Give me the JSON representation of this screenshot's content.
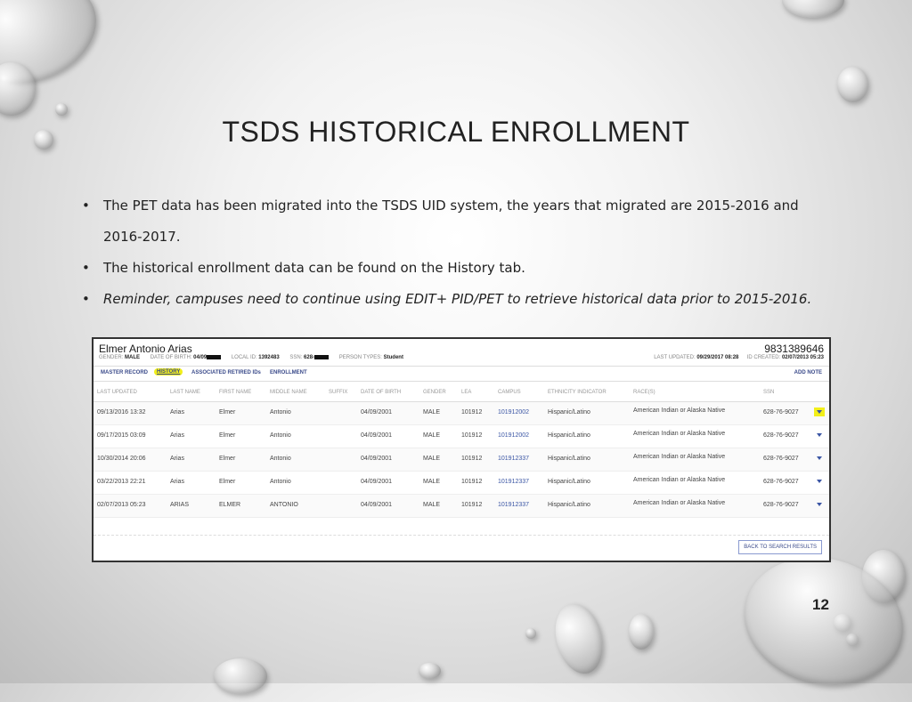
{
  "slide": {
    "title": "TSDS HISTORICAL ENROLLMENT",
    "bullets": [
      "The PET data has been migrated into the TSDS UID system, the years that migrated are 2015-2016 and 2016-2017.",
      "The historical enrollment data can be found on the History tab.",
      "Reminder, campuses need to continue using EDIT+ PID/PET to retrieve historical data prior to 2015-2016."
    ],
    "page_number": "12"
  },
  "record": {
    "name": "Elmer Antonio Arias",
    "id": "9831389646",
    "gender_label": "GENDER:",
    "gender": "MALE",
    "dob_label": "DATE OF BIRTH:",
    "dob": "04/09",
    "local_id_label": "LOCAL ID:",
    "local_id": "1392483",
    "ssn_label": "SSN:",
    "ssn": "628-",
    "person_types_label": "PERSON TYPES:",
    "person_types": "Student",
    "last_updated_label": "LAST UPDATED:",
    "last_updated": "09/29/2017 08:28",
    "id_created_label": "ID CREATED:",
    "id_created": "02/07/2013 05:23"
  },
  "tabs": {
    "master_record": "MASTER RECORD",
    "history": "HISTORY",
    "associated": "ASSOCIATED RETIRED IDs",
    "enrollment": "ENROLLMENT",
    "add_note": "ADD NOTE"
  },
  "table": {
    "headers": [
      "LAST UPDATED",
      "LAST NAME",
      "FIRST NAME",
      "MIDDLE NAME",
      "SUFFIX",
      "DATE OF BIRTH",
      "GENDER",
      "LEA",
      "CAMPUS",
      "ETHNICITY INDICATOR",
      "RACE(S)",
      "SSN"
    ],
    "rows": [
      {
        "last_updated": "09/13/2016 13:32",
        "last_name": "Arias",
        "first_name": "Elmer",
        "middle_name": "Antonio",
        "dob": "04/09/2001",
        "gender": "MALE",
        "lea": "101912",
        "campus": "101912002",
        "ethnicity": "Hispanic/Latino",
        "race": "American Indian or Alaska Native",
        "ssn": "628-76-9027"
      },
      {
        "last_updated": "09/17/2015 03:09",
        "last_name": "Arias",
        "first_name": "Elmer",
        "middle_name": "Antonio",
        "dob": "04/09/2001",
        "gender": "MALE",
        "lea": "101912",
        "campus": "101912002",
        "ethnicity": "Hispanic/Latino",
        "race": "American Indian or Alaska Native",
        "ssn": "628-76-9027"
      },
      {
        "last_updated": "10/30/2014 20:06",
        "last_name": "Arias",
        "first_name": "Elmer",
        "middle_name": "Antonio",
        "dob": "04/09/2001",
        "gender": "MALE",
        "lea": "101912",
        "campus": "101912337",
        "ethnicity": "Hispanic/Latino",
        "race": "American Indian or Alaska Native",
        "ssn": "628-76-9027"
      },
      {
        "last_updated": "03/22/2013 22:21",
        "last_name": "Arias",
        "first_name": "Elmer",
        "middle_name": "Antonio",
        "dob": "04/09/2001",
        "gender": "MALE",
        "lea": "101912",
        "campus": "101912337",
        "ethnicity": "Hispanic/Latino",
        "race": "American Indian or Alaska Native",
        "ssn": "628-76-9027"
      },
      {
        "last_updated": "02/07/2013 05:23",
        "last_name": "ARIAS",
        "first_name": "ELMER",
        "middle_name": "ANTONIO",
        "dob": "04/09/2001",
        "gender": "MALE",
        "lea": "101912",
        "campus": "101912337",
        "ethnicity": "Hispanic/Latino",
        "race": "American Indian or Alaska Native",
        "ssn": "628-76-9027"
      }
    ]
  },
  "footer": {
    "back_button": "BACK TO SEARCH RESULTS"
  }
}
